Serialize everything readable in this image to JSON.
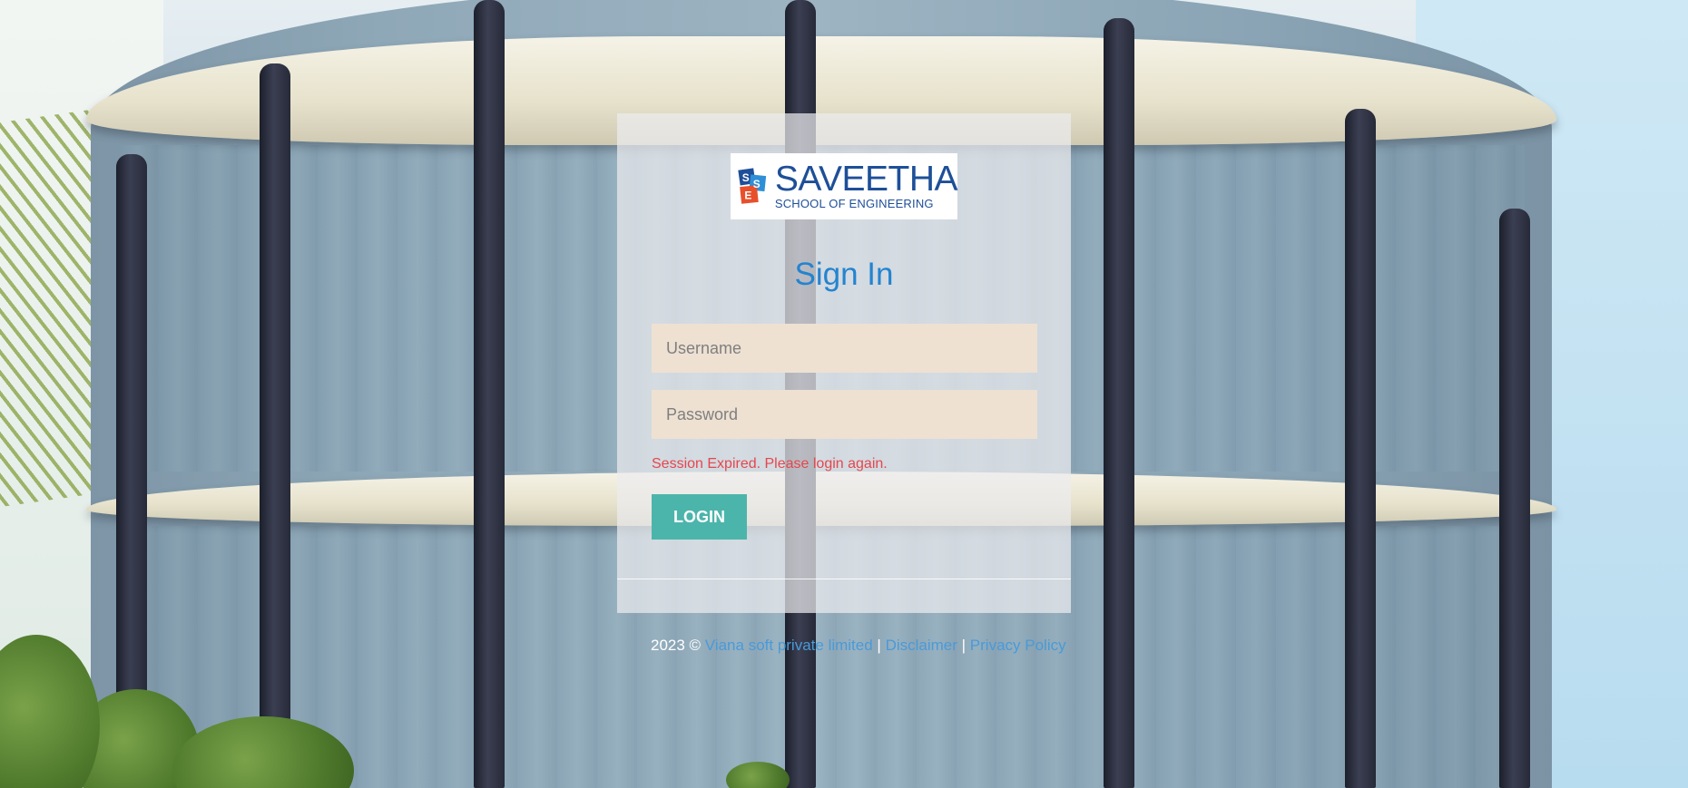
{
  "logo": {
    "name": "SAVEETHA",
    "subtitle": "SCHOOL OF ENGINEERING"
  },
  "form": {
    "title": "Sign In",
    "username_placeholder": "Username",
    "password_placeholder": "Password",
    "error_message": "Session Expired. Please login again.",
    "login_label": "LOGIN"
  },
  "footer": {
    "copyright": "2023 © ",
    "company_link": "Viana soft private limited",
    "separator": " | ",
    "disclaimer_link": "Disclaimer",
    "privacy_link": "Privacy Policy"
  },
  "colors": {
    "title": "#2484cf",
    "input_bg": "#eee1d2",
    "error": "#e5474d",
    "button": "#4cb5ab",
    "link": "#4a9ad8"
  }
}
